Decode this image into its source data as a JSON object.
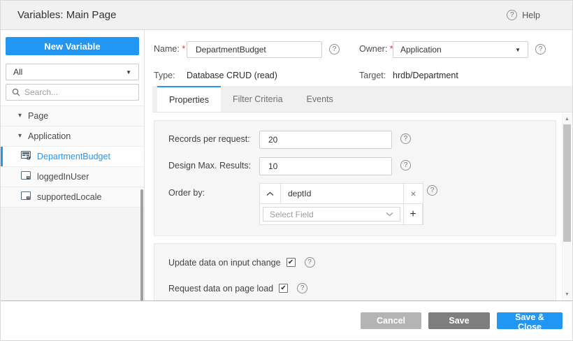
{
  "header": {
    "title": "Variables: Main Page",
    "help_label": "Help"
  },
  "sidebar": {
    "new_variable_button": "New Variable",
    "filter_selected": "All",
    "search_placeholder": "Search...",
    "tree": [
      {
        "label": "Page",
        "type": "group"
      },
      {
        "label": "Application",
        "type": "group"
      },
      {
        "label": "DepartmentBudget",
        "type": "crud-variable",
        "selected": true
      },
      {
        "label": "loggedInUser",
        "type": "static-variable",
        "selected": false
      },
      {
        "label": "supportedLocale",
        "type": "static-variable",
        "selected": false
      }
    ]
  },
  "details": {
    "name_label": "Name:",
    "required_marker": "*",
    "name_value": "DepartmentBudget",
    "owner_label": "Owner:",
    "owner_value": "Application",
    "type_label": "Type:",
    "type_value": "Database CRUD (read)",
    "target_label": "Target:",
    "target_value": "hrdb/Department"
  },
  "tabs": [
    {
      "label": "Properties",
      "active": true
    },
    {
      "label": "Filter Criteria",
      "active": false
    },
    {
      "label": "Events",
      "active": false
    }
  ],
  "properties": {
    "records_per_request": {
      "label": "Records per request:",
      "value": "20"
    },
    "design_max_results": {
      "label": "Design Max. Results:",
      "value": "10"
    },
    "order_by": {
      "label": "Order by:",
      "field_value": "deptId",
      "select_placeholder": "Select Field"
    },
    "update_on_input": {
      "label": "Update data on input change",
      "checked": true
    },
    "request_on_load": {
      "label": "Request data on page load",
      "checked": true
    }
  },
  "footer": {
    "cancel_label": "Cancel",
    "save_label": "Save",
    "save_close_label": "Save & Close"
  },
  "icons": {
    "help_glyph": "?",
    "caret_down": "▼",
    "tree_caret": "▾",
    "remove": "×",
    "add": "+",
    "check": "✔",
    "scroll_up": "▲",
    "scroll_down": "▼"
  },
  "colors": {
    "accent": "#2196f3",
    "cancel_button": "#b4b4b4",
    "save_button": "#7e7e7e",
    "selected_text": "#2196f3"
  }
}
